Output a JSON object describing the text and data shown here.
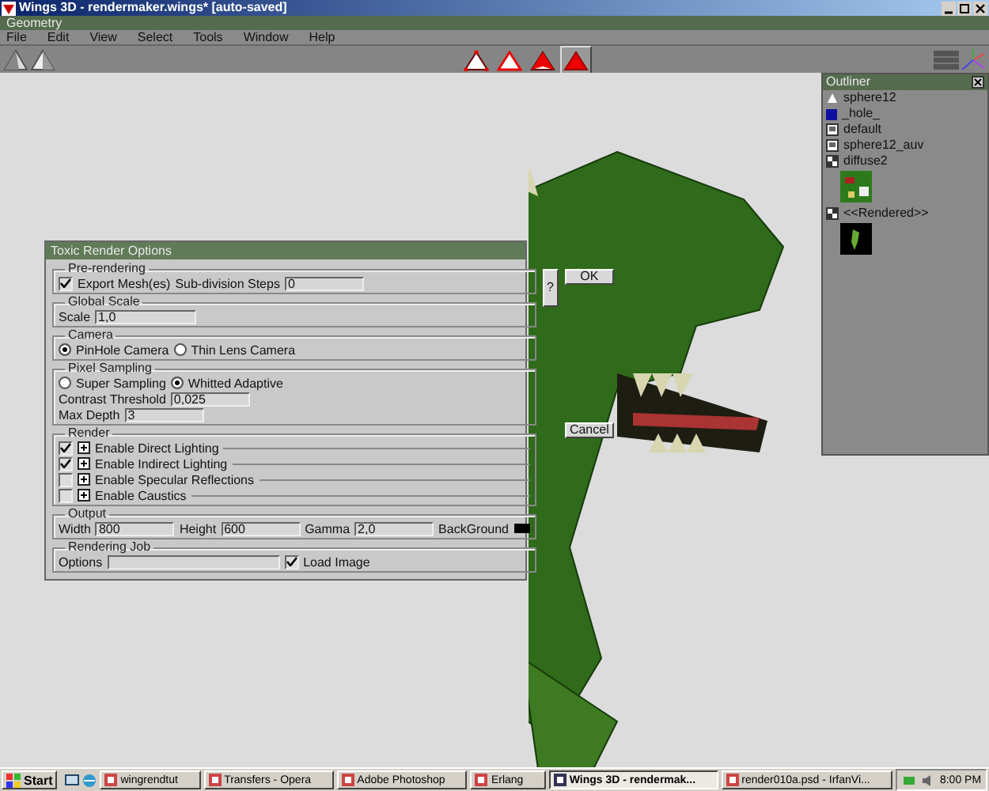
{
  "window": {
    "title": "Wings 3D - rendermaker.wings* [auto-saved]"
  },
  "geometry_bar": {
    "title": "Geometry"
  },
  "menu": [
    "File",
    "Edit",
    "View",
    "Select",
    "Tools",
    "Window",
    "Help"
  ],
  "selection_modes": [
    {
      "kind": "vertex",
      "selected": false
    },
    {
      "kind": "edge",
      "selected": false
    },
    {
      "kind": "face",
      "selected": false
    },
    {
      "kind": "body",
      "selected": true
    }
  ],
  "outliner": {
    "title": "Outliner",
    "items": [
      {
        "kind": "mesh",
        "label": "sphere12"
      },
      {
        "kind": "swatch",
        "label": "_hole_",
        "color": "#1010a0"
      },
      {
        "kind": "material",
        "label": "default"
      },
      {
        "kind": "material",
        "label": "sphere12_auv"
      },
      {
        "kind": "image",
        "label": "diffuse2",
        "thumbnail": {
          "kind": "texture"
        }
      },
      {
        "kind": "image",
        "label": "<<Rendered>>",
        "thumbnail": {
          "kind": "render"
        }
      }
    ]
  },
  "dialog": {
    "title": "Toxic Render Options",
    "buttons": [
      {
        "kind": "help",
        "label": "?"
      },
      {
        "kind": "ok",
        "label": "OK"
      },
      {
        "kind": "cancel",
        "label": "Cancel"
      }
    ],
    "sections": [
      {
        "title": "Pre-rendering",
        "rows": [
          [
            {
              "kind": "checkbox",
              "label": "Export Mesh(es)",
              "checked": true
            },
            {
              "kind": "field",
              "label": "Sub-division Steps",
              "value": "0"
            }
          ]
        ]
      },
      {
        "title": "Global Scale",
        "rows": [
          [
            {
              "kind": "field",
              "label": "Scale",
              "value": "1,0"
            }
          ]
        ]
      },
      {
        "title": "Camera",
        "rows": [
          [
            {
              "kind": "radio",
              "label": "PinHole Camera",
              "selected": true
            },
            {
              "kind": "radio",
              "label": "Thin Lens Camera",
              "selected": false
            }
          ]
        ]
      },
      {
        "title": "Pixel Sampling",
        "rows": [
          [
            {
              "kind": "radio",
              "label": "Super Sampling",
              "selected": false
            },
            {
              "kind": "radio",
              "label": "Whitted Adaptive",
              "selected": true
            }
          ],
          [
            {
              "kind": "field",
              "label": "Contrast Threshold",
              "value": "0,025"
            }
          ],
          [
            {
              "kind": "field",
              "label": "Max Depth",
              "value": "3"
            }
          ]
        ]
      },
      {
        "title": "Render",
        "rows": [
          [
            {
              "kind": "option",
              "label": "Enable Direct Lighting",
              "checked": true
            }
          ],
          [
            {
              "kind": "option",
              "label": "Enable Indirect Lighting",
              "checked": true
            }
          ],
          [
            {
              "kind": "option",
              "label": "Enable Specular Reflections",
              "checked": false
            }
          ],
          [
            {
              "kind": "option",
              "label": "Enable Caustics",
              "checked": false
            }
          ]
        ]
      },
      {
        "title": "Output",
        "rows": [
          [
            {
              "kind": "field",
              "label": "Width",
              "value": "800"
            },
            {
              "kind": "field",
              "label": "Height",
              "value": "600"
            },
            {
              "kind": "field",
              "label": "Gamma",
              "value": "2,0"
            },
            {
              "kind": "color",
              "label": "BackGround",
              "color": "#000000"
            }
          ]
        ]
      },
      {
        "title": "Rendering Job",
        "rows": [
          [
            {
              "kind": "wide-field",
              "label": "Options"
            },
            {
              "kind": "checkbox",
              "label": "Load Image",
              "checked": true
            }
          ]
        ]
      }
    ]
  },
  "taskbar": {
    "start": "Start",
    "tasks": [
      {
        "label": "wingrendtut",
        "selected": false
      },
      {
        "label": "Transfers - Opera",
        "selected": false
      },
      {
        "label": "Adobe Photoshop",
        "selected": false
      },
      {
        "label": "Erlang",
        "selected": false
      },
      {
        "label": "Wings 3D - rendermak...",
        "selected": true
      },
      {
        "label": "render010a.psd - IrfanVi...",
        "selected": false
      }
    ],
    "clock": "8:00 PM"
  }
}
